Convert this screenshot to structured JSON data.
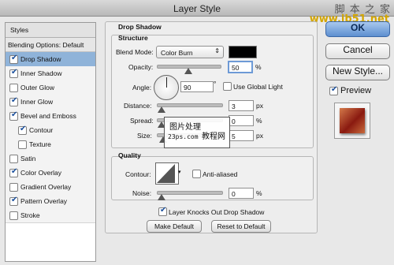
{
  "window": {
    "title": "Layer Style"
  },
  "watermark": {
    "line1": "脚 本 之 家",
    "line2": "www.jb51.net",
    "overlay_line1": "图片处理",
    "overlay_line2": "23ps.com",
    "overlay_line3": "教程网"
  },
  "styles_panel": {
    "header": "Styles",
    "blending_options": "Blending Options: Default",
    "items": [
      {
        "label": "Drop Shadow",
        "checked": true,
        "selected": true
      },
      {
        "label": "Inner Shadow",
        "checked": true
      },
      {
        "label": "Outer Glow",
        "checked": false
      },
      {
        "label": "Inner Glow",
        "checked": true
      },
      {
        "label": "Bevel and Emboss",
        "checked": true
      },
      {
        "label": "Contour",
        "checked": true,
        "sub": true
      },
      {
        "label": "Texture",
        "checked": false,
        "sub": true
      },
      {
        "label": "Satin",
        "checked": false
      },
      {
        "label": "Color Overlay",
        "checked": true
      },
      {
        "label": "Gradient Overlay",
        "checked": false
      },
      {
        "label": "Pattern Overlay",
        "checked": true
      },
      {
        "label": "Stroke",
        "checked": false
      }
    ]
  },
  "drop_shadow": {
    "section_title": "Drop Shadow",
    "structure": {
      "title": "Structure",
      "blend_mode_label": "Blend Mode:",
      "blend_mode_value": "Color Burn",
      "shadow_color": "#000000",
      "opacity_label": "Opacity:",
      "opacity_value": "50",
      "opacity_unit": "%",
      "opacity_fraction": 0.5,
      "angle_label": "Angle:",
      "angle_value": "90",
      "angle_unit": "°",
      "use_global_light_label": "Use Global Light",
      "use_global_light": false,
      "distance_label": "Distance:",
      "distance_value": "3",
      "distance_unit": "px",
      "spread_label": "Spread:",
      "spread_value": "0",
      "spread_unit": "%",
      "size_label": "Size:",
      "size_value": "5",
      "size_unit": "px"
    },
    "quality": {
      "title": "Quality",
      "contour_label": "Contour:",
      "anti_aliased_label": "Anti-aliased",
      "anti_aliased": false,
      "noise_label": "Noise:",
      "noise_value": "0",
      "noise_unit": "%"
    },
    "knockout_label": "Layer Knocks Out Drop Shadow",
    "knockout": true,
    "make_default_label": "Make Default",
    "reset_default_label": "Reset to Default"
  },
  "right_buttons": {
    "ok_label": "OK",
    "cancel_label": "Cancel",
    "new_style_label": "New Style...",
    "preview_label": "Preview",
    "preview_checked": true
  }
}
